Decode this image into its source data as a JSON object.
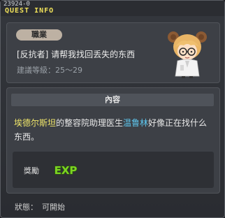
{
  "header": {
    "quest_id": "23924-0",
    "title": "QUEST INFO"
  },
  "quest": {
    "job_label": "職業",
    "name": "[反抗者] 请帮我找回丢失的东西",
    "level_label": "建議等級：25～29"
  },
  "content": {
    "header": "內容",
    "desc_part1": "埃德尔斯坦",
    "desc_part2": "的整容院助理医生",
    "desc_part3": "温鲁林",
    "desc_part4": "好像正在找什么东西。"
  },
  "reward": {
    "label": "獎勵",
    "icon": "exp-icon",
    "icon_text": "EXP"
  },
  "status": {
    "label": "狀態：",
    "value": "可開始"
  },
  "colors": {
    "title": "#f1e25a",
    "npc_highlight": "#5ec8f0",
    "place_highlight": "#f0e66a",
    "exp": "#7cd422"
  }
}
